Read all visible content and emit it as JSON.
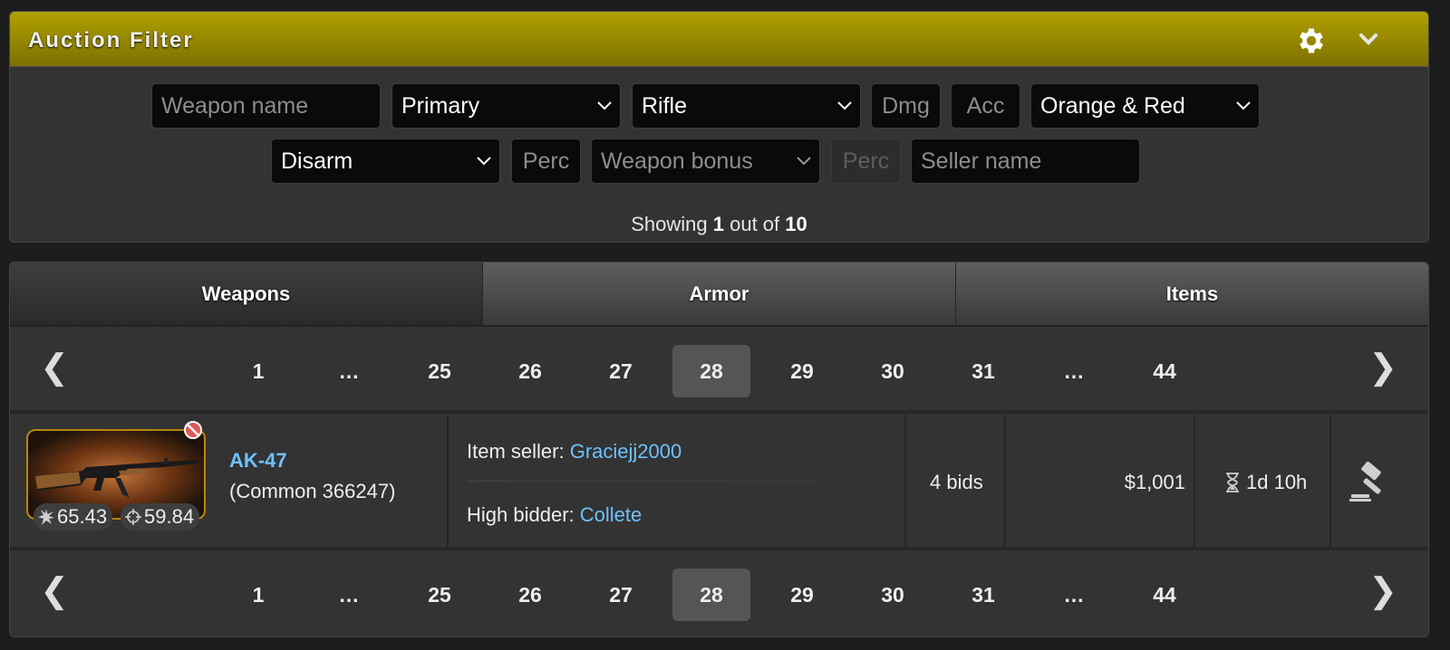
{
  "filter": {
    "title": "Auction Filter",
    "weapon_name_placeholder": "Weapon name",
    "slot_value": "Primary",
    "type_value": "Rifle",
    "dmg_placeholder": "Dmg",
    "acc_placeholder": "Acc",
    "rarity_value": "Orange & Red",
    "bonus1_value": "Disarm",
    "perc1_placeholder": "Perc",
    "bonus2_value": "Weapon bonus",
    "perc2_placeholder": "Perc",
    "seller_placeholder": "Seller name",
    "showing_prefix": "Showing",
    "showing_current": "1",
    "showing_mid": "out of",
    "showing_total": "10"
  },
  "tabs": [
    {
      "label": "Weapons",
      "active": true
    },
    {
      "label": "Armor",
      "active": false
    },
    {
      "label": "Items",
      "active": false
    }
  ],
  "pagination": {
    "prev": "❮",
    "next": "❯",
    "pages": [
      "1",
      "…",
      "25",
      "26",
      "27",
      "28",
      "29",
      "30",
      "31",
      "…",
      "44"
    ],
    "active_page": "28"
  },
  "listing": {
    "name": "AK-47",
    "subtitle": "(Common 366247)",
    "damage": "65.43",
    "accuracy": "59.84",
    "seller_label": "Item seller:",
    "seller": "Graciejj2000",
    "bidder_label": "High bidder:",
    "bidder": "Collete",
    "bids": "4 bids",
    "price": "$1,001",
    "time_left": "1d 10h"
  },
  "colors": {
    "header_gold": "#b0a000",
    "link_blue": "#6ec1ff",
    "rarity_border": "#b8860b"
  },
  "icons": [
    "gear-icon",
    "chevron-down-icon",
    "block-icon",
    "damage-icon",
    "accuracy-icon",
    "hourglass-icon",
    "gavel-icon"
  ]
}
